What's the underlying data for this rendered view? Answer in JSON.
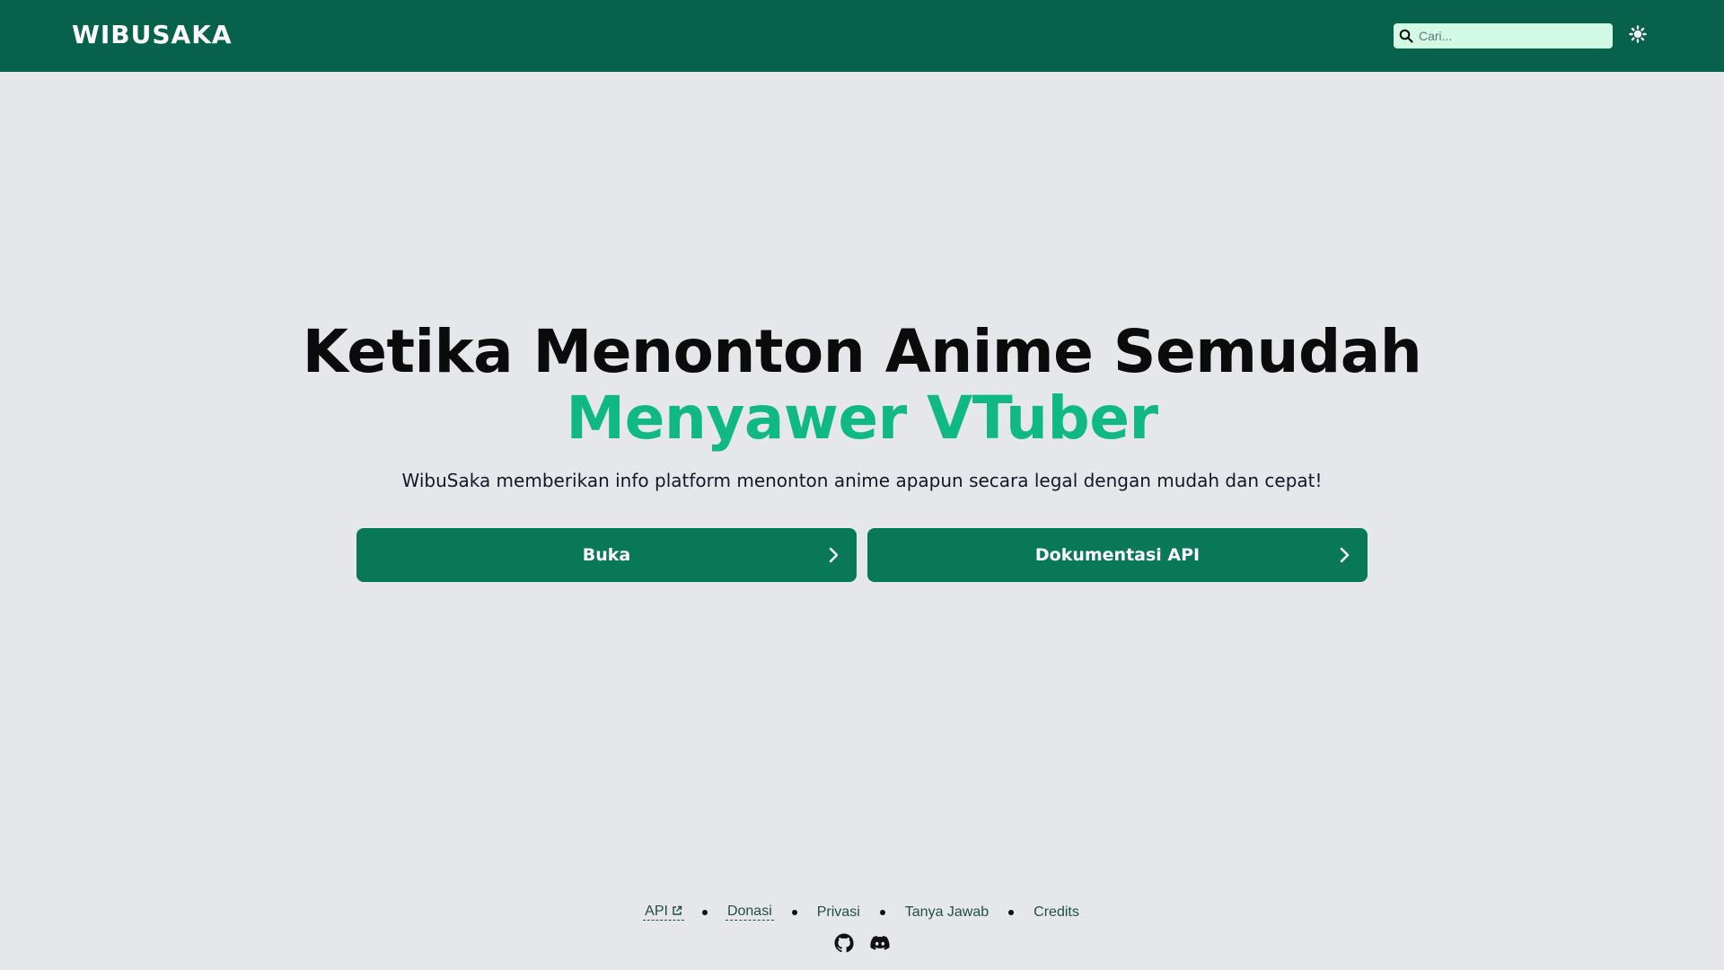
{
  "header": {
    "logo": "WIBUSAKA",
    "search_placeholder": "Cari...",
    "icons": {
      "search": "search-icon",
      "theme": "sun-icon"
    }
  },
  "hero": {
    "title_line1": "Ketika Menonton Anime Semudah",
    "title_line2": "Menyawer VTuber",
    "subtitle": "WibuSaka memberikan info platform menonton anime apapun secara legal dengan mudah dan cepat!"
  },
  "actions": {
    "open_label": "Buka",
    "docs_label": "Dokumentasi API"
  },
  "footer": {
    "links": {
      "api": "API",
      "donasi": "Donasi",
      "privasi": "Privasi",
      "tanya_jawab": "Tanya Jawab",
      "credits": "Credits"
    },
    "social": [
      "github-icon",
      "discord-icon"
    ]
  },
  "colors": {
    "header_bg": "#07614b",
    "page_bg": "#e5e7eb",
    "accent": "#10b981",
    "button_bg": "#087856",
    "search_bg": "#d1fae5"
  }
}
